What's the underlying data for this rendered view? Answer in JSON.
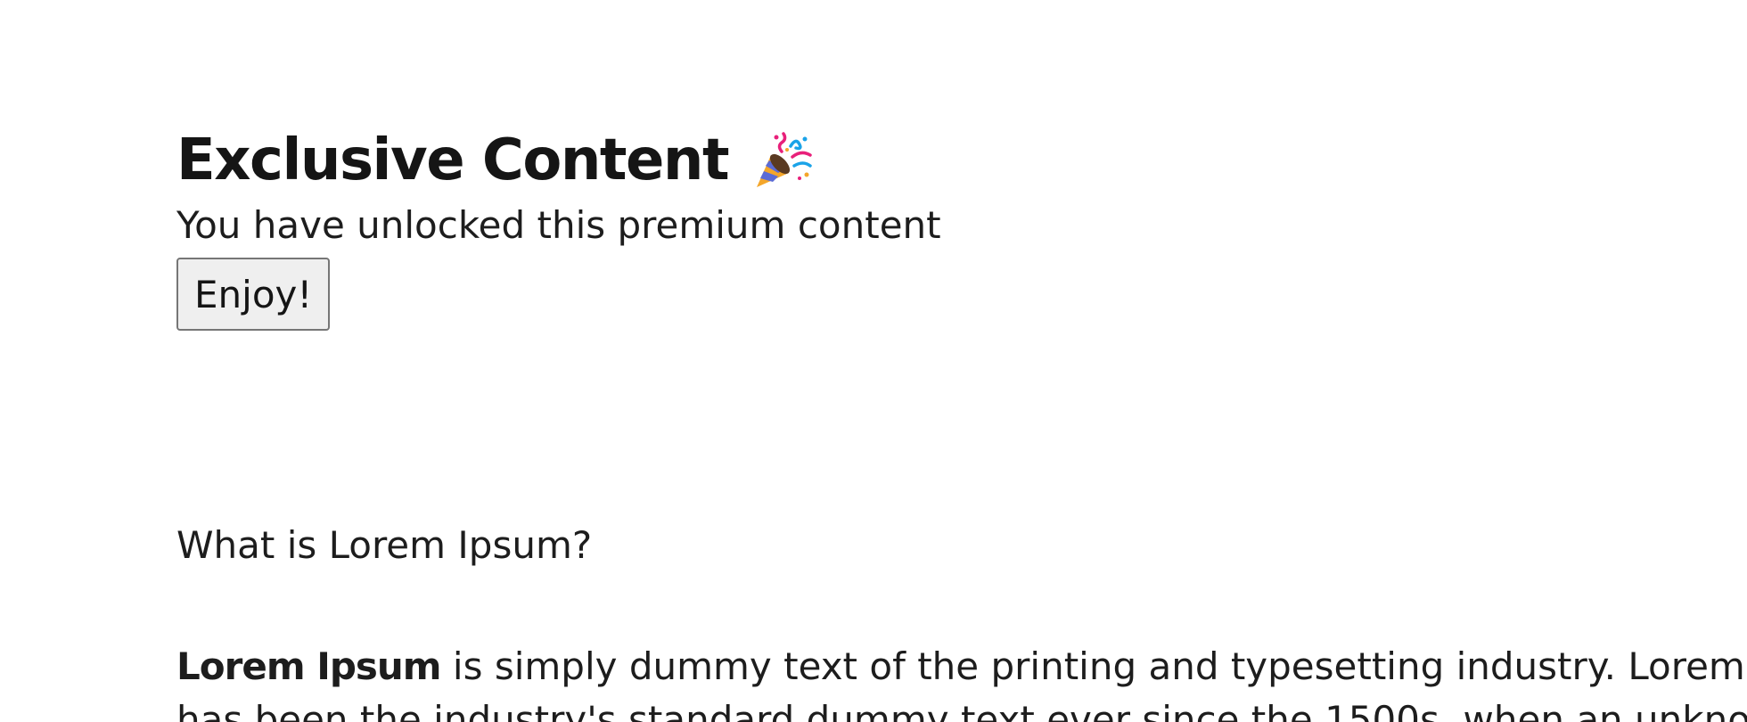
{
  "header": {
    "title": "Exclusive Content",
    "title_icon": "party-popper-icon",
    "subtitle": "You have unlocked this premium content",
    "enjoy_button_label": "Enjoy!"
  },
  "article": {
    "question": "What is Lorem Ipsum?",
    "lead_bold": "Lorem Ipsum",
    "lead_rest": " is simply dummy text of the printing and typesetting industry. Lorem Ipsum",
    "second_line_partial": "has been the industry's standard dummy text ever since the 1500s, when an unknown"
  },
  "colors": {
    "text": "#1a1a1a",
    "button_bg": "#efefef",
    "button_border": "#767676",
    "confetti_pink": "#e8207a",
    "confetti_blue": "#1aa3e8",
    "cone_orange": "#f4a62a"
  }
}
